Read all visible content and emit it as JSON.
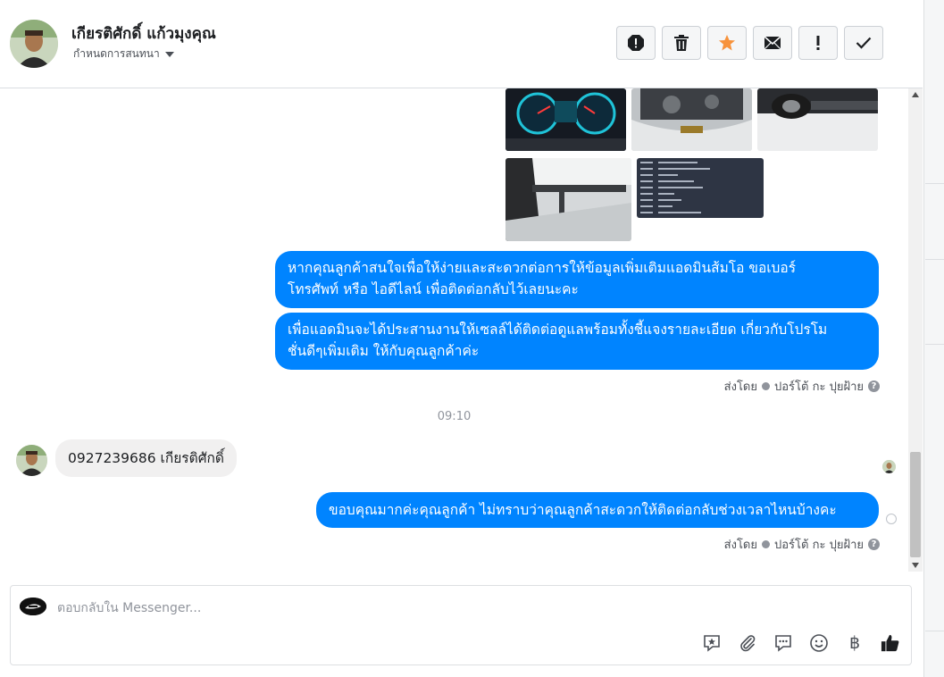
{
  "header": {
    "contact_name": "เกียรติศักดิ์ แก้วมุงคุณ",
    "conversation_settings": "กำหนดการสนทนา",
    "actions": [
      "spam-icon",
      "trash-icon",
      "star-icon",
      "envelope-icon",
      "exclamation-icon",
      "check-icon"
    ]
  },
  "thread": {
    "outgoing_messages": [
      {
        "lines": [
          "หากคุณลูกค้าสนใจเพื่อให้ง่ายและสะดวกต่อการให้ข้อมูลเพิ่มเติมแอดมินส้มโอ ขอเบอร์",
          "โทรศัพท์ หรือ ไอดีไลน์ เพื่อติดต่อกลับไว้เลยนะคะ"
        ]
      },
      {
        "lines": [
          "เพื่อแอดมินจะได้ประสานงานให้เซลล์ได้ติดต่อดูแลพร้อมทั้งชี้แจงรายละเอียด เกี่ยวกับโปรโม",
          "ชั่นดีๆเพิ่มเติม ให้กับคุณลูกค้าค่ะ"
        ]
      }
    ],
    "sent_by_1": {
      "prefix": "ส่งโดย",
      "name": "ปอร์โต้ กะ ปุยฝ้าย"
    },
    "timestamp": "09:10",
    "incoming_message": "0927239686 เกียรติศักดิ์",
    "reply_message": "ขอบคุณมากค่ะคุณลูกค้า ไม่ทราบว่าคุณลูกค้าสะดวกให้ติดต่อกลับช่วงเวลาไหนบ้างคะ",
    "sent_by_2": {
      "prefix": "ส่งโดย",
      "name": "ปอร์โต้ กะ ปุยฝ้าย"
    }
  },
  "composer": {
    "placeholder": "ตอบกลับใน Messenger...",
    "tools": [
      "saved-reply-icon",
      "attachment-icon",
      "chat-bubble-icon",
      "emoji-icon",
      "baht-icon",
      "thumbs-up-icon"
    ],
    "baht_symbol": "฿"
  },
  "colors": {
    "accent": "#0084ff",
    "incoming_bubble": "#f1f0f0",
    "muted": "#90949c"
  }
}
